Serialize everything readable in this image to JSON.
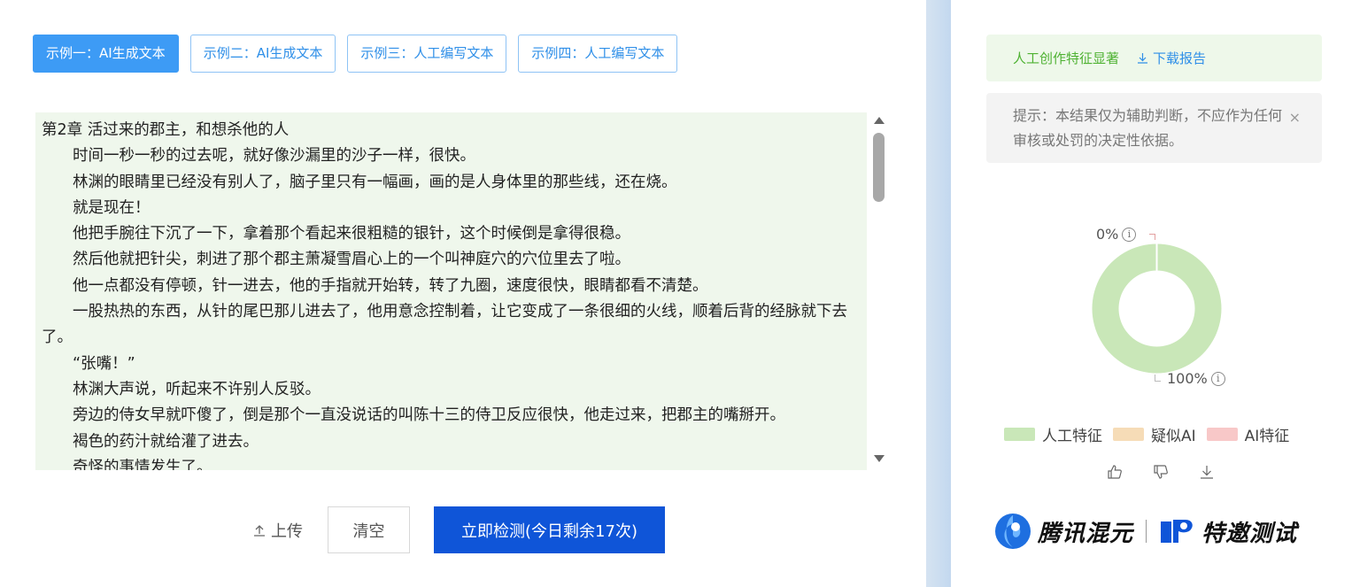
{
  "tabs": [
    {
      "label": "示例一：AI生成文本",
      "active": true
    },
    {
      "label": "示例二：AI生成文本",
      "active": false
    },
    {
      "label": "示例三：人工编写文本",
      "active": false
    },
    {
      "label": "示例四：人工编写文本",
      "active": false
    }
  ],
  "text_lines": [
    "第2章 活过来的郡主，和想杀他的人",
    "时间一秒一秒的过去呢，就好像沙漏里的沙子一样，很快。",
    "林渊的眼睛里已经没有别人了，脑子里只有一幅画，画的是人身体里的那些线，还在烧。",
    "就是现在！",
    "他把手腕往下沉了一下，拿着那个看起来很粗糙的银针，这个时候倒是拿得很稳。",
    "然后他就把针尖，刺进了那个郡主萧凝雪眉心上的一个叫神庭穴的穴位里去了啦。",
    "他一点都没有停顿，针一进去，他的手指就开始转，转了九圈，速度很快，眼睛都看不清楚。",
    "一股热热的东西，从针的尾巴那儿进去了，他用意念控制着，让它变成了一条很细的火线，顺着后背的经脉就下去了。",
    "“张嘴！”",
    "林渊大声说，听起来不许别人反驳。",
    "旁边的侍女早就吓傻了，倒是那个一直没说话的叫陈十三的侍卫反应很快，他走过来，把郡主的嘴掰开。",
    "褐色的药汁就给灌了进去。",
    "奇怪的事情发生了。"
  ],
  "actions": {
    "upload_label": "上传",
    "clear_label": "清空",
    "detect_label": "立即检测(今日剩余17次)"
  },
  "result": {
    "verdict": "人工创作特征显著",
    "download_label": "下载报告"
  },
  "hint": {
    "text": "提示：本结果仅为辅助判断，不应作为任何审核或处罚的决定性依据。",
    "close_icon": "×"
  },
  "chart_data": {
    "type": "pie",
    "style": "donut",
    "labels": [
      "人工特征",
      "疑似AI",
      "AI特征"
    ],
    "values": [
      100,
      0,
      0
    ],
    "value_labels": [
      "100%",
      "0%"
    ],
    "colors": [
      "#c9e7b8",
      "#f6dcb7",
      "#f8c8c8"
    ]
  },
  "labels": {
    "pct_small": "0%",
    "pct_large": "100%",
    "info": "i"
  },
  "legend": [
    {
      "label": "人工特征",
      "color": "#c9e7b8"
    },
    {
      "label": "疑似AI",
      "color": "#f6dcb7"
    },
    {
      "label": "AI特征",
      "color": "#f8c8c8"
    }
  ],
  "brand": {
    "name": "腾讯混元",
    "tagline": "特邀测试"
  }
}
